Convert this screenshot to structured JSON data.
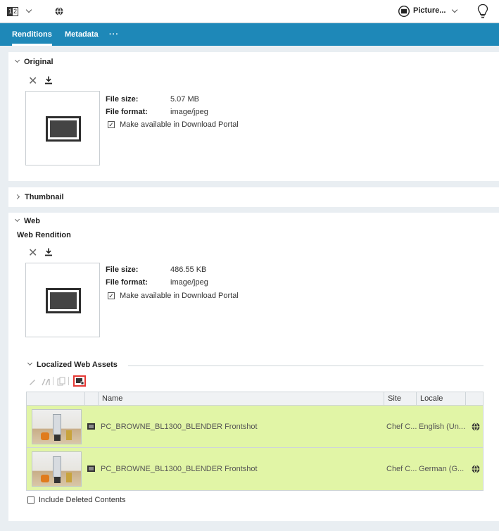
{
  "toolbar": {
    "page_left": "1",
    "page_right": "2",
    "picture_label": "Picture...",
    "colors": {
      "tab_bar": "#1e88b8",
      "row_highlight": "#e1f5a6",
      "selected_border": "#e53935"
    }
  },
  "tabs": [
    {
      "label": "Renditions",
      "active": true
    },
    {
      "label": "Metadata",
      "active": false
    },
    {
      "label": "···",
      "active": false
    }
  ],
  "original": {
    "heading": "Original",
    "file_size_label": "File size:",
    "file_size": "5.07 MB",
    "file_format_label": "File format:",
    "file_format": "image/jpeg",
    "download_portal": "Make available in Download Portal",
    "download_portal_checked": true
  },
  "thumbnail": {
    "heading": "Thumbnail"
  },
  "web": {
    "heading": "Web",
    "subheading": "Web Rendition",
    "file_size_label": "File size:",
    "file_size": "486.55 KB",
    "file_format_label": "File format:",
    "file_format": "image/jpeg",
    "download_portal": "Make available in Download Portal",
    "download_portal_checked": true
  },
  "localized": {
    "heading": "Localized Web Assets",
    "columns": {
      "name": "Name",
      "site": "Site",
      "locale": "Locale"
    },
    "rows": [
      {
        "name": "PC_BROWNE_BL1300_BLENDER Frontshot",
        "site": "Chef C...",
        "locale": "English (Un..."
      },
      {
        "name": "PC_BROWNE_BL1300_BLENDER Frontshot",
        "site": "Chef C...",
        "locale": "German (G..."
      }
    ],
    "include_deleted": "Include Deleted Contents",
    "include_deleted_checked": false
  }
}
